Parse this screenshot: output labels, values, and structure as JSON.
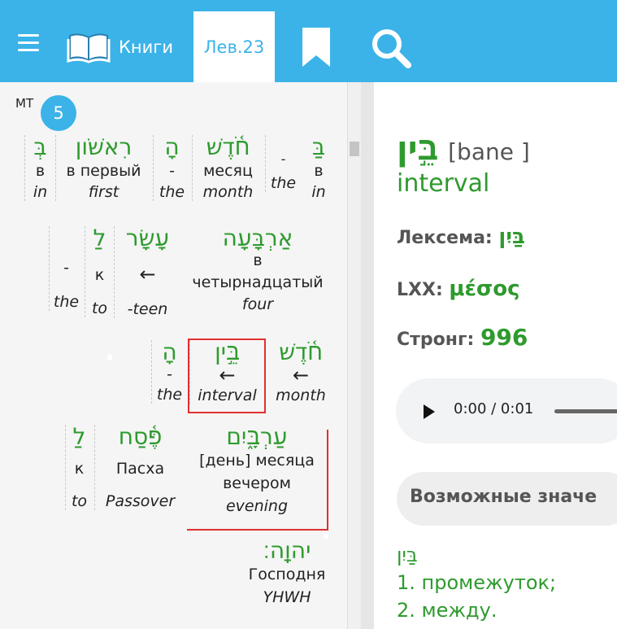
{
  "topbar": {
    "books_label": "Книги",
    "chapter_label": "Лев.23"
  },
  "text_panel": {
    "source_label": "MT",
    "verse_number": "5",
    "words": [
      {
        "heb": "בַּ",
        "ru": "в",
        "en": "in"
      },
      {
        "heb": "-",
        "ru": "",
        "en": "the"
      },
      {
        "heb": "חֹ֫דֶשׁ",
        "ru": "месяц",
        "en": "month"
      },
      {
        "heb": "הָ",
        "ru": "-",
        "en": "the"
      },
      {
        "heb": "רִאשֹׁון",
        "ru": "в первый",
        "en": "first"
      },
      {
        "heb": "בְּ",
        "ru": "в",
        "en": "in"
      },
      {
        "heb": "אַרְבָּעָה",
        "ru": "в",
        "ru2": "четырнадцатый",
        "en": "four"
      },
      {
        "heb": "עָשָׂר",
        "ru": "←",
        "en": "-teen"
      },
      {
        "heb": "לַ",
        "ru": "к",
        "en": "to"
      },
      {
        "heb": "",
        "ru": "-",
        "en": "the"
      },
      {
        "heb": "חֹ֫דֶשׁ",
        "ru": "←",
        "en": "month"
      },
      {
        "heb": "בֵּ֣ין",
        "ru": "←",
        "en": "interval"
      },
      {
        "heb": "הָ",
        "ru": "-",
        "en": "the"
      },
      {
        "heb": "עַרְבָּ֑יִם",
        "ru": "[день] месяца",
        "ru2": "вечером",
        "en": "evening"
      },
      {
        "heb": "פֶּ֫סַח",
        "ru": "Пасха",
        "en": "Passover"
      },
      {
        "heb": "לַ",
        "ru": "к",
        "en": "to"
      },
      {
        "heb": "יהוָֽה׃",
        "ru": "Господня",
        "en": "YHWH"
      }
    ]
  },
  "detail": {
    "headword": "בֵּ֣ין",
    "transliteration": "[bane ]",
    "gloss": "interval",
    "lexeme_label": "Лексема:",
    "lexeme_value": "בַּיִן",
    "lxx_label": "LXX:",
    "lxx_value": "μέσος",
    "strong_label": "Стронг:",
    "strong_value": "996",
    "audio_time": "0:00 / 0:01",
    "meanings_header": "Возможные значе",
    "meanings": [
      "בַּיִן",
      "1. промежуток;",
      "2. между."
    ]
  },
  "colors": {
    "accent": "#3bb3e8",
    "hebrew_green": "#2e9a2e",
    "selection_red": "#e03030"
  }
}
